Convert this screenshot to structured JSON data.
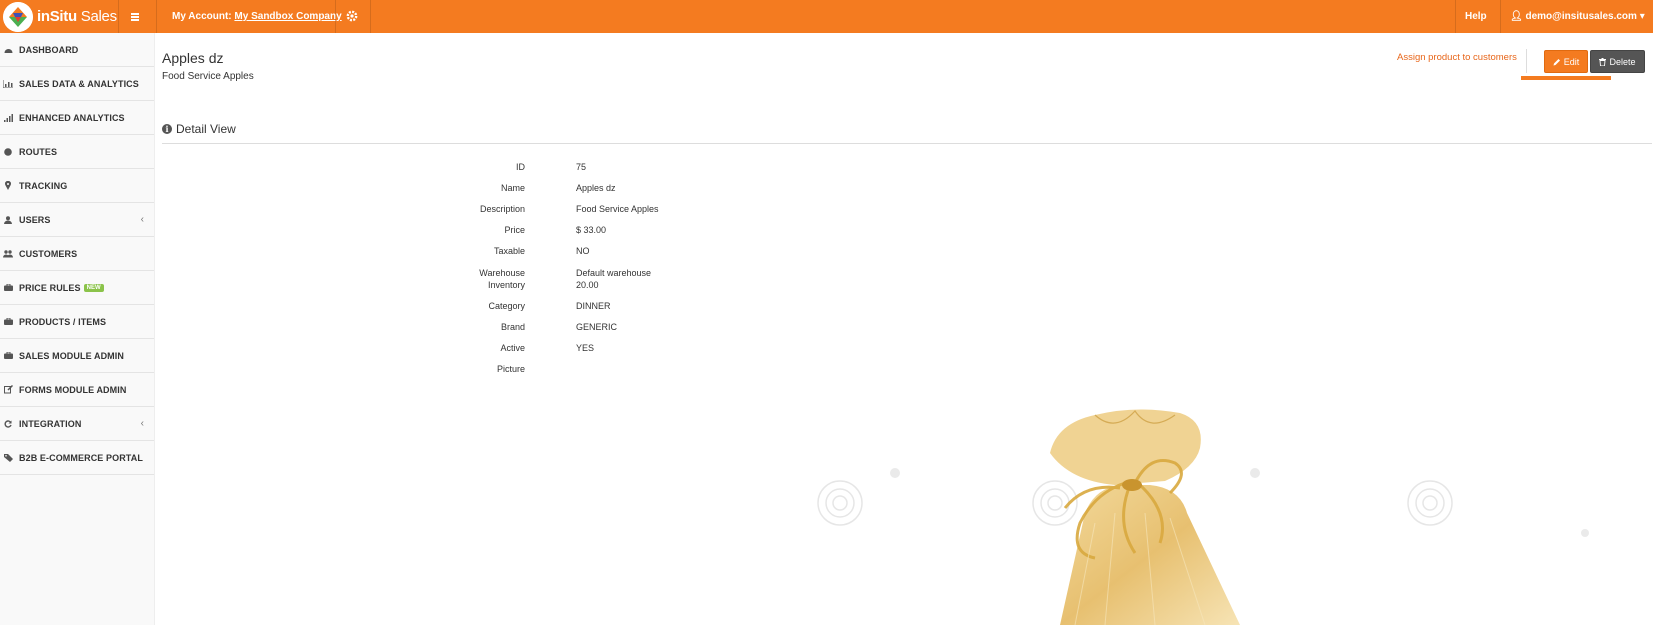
{
  "header": {
    "brand_bold": "inSitu",
    "brand_light": " Sales",
    "account_label": "My Account:",
    "account_name": "My Sandbox Company",
    "help": "Help",
    "user": "demo@insitusales.com"
  },
  "sidebar": {
    "items": [
      {
        "label": "DASHBOARD",
        "icon": "dashboard-icon"
      },
      {
        "label": "SALES DATA & ANALYTICS",
        "icon": "bar-chart-icon"
      },
      {
        "label": "ENHANCED ANALYTICS",
        "icon": "signal-icon"
      },
      {
        "label": "ROUTES",
        "icon": "globe-icon"
      },
      {
        "label": "TRACKING",
        "icon": "map-marker-icon"
      },
      {
        "label": "USERS",
        "icon": "user-icon"
      },
      {
        "label": "CUSTOMERS",
        "icon": "users-icon"
      },
      {
        "label": "PRICE RULES",
        "icon": "briefcase-icon",
        "badge": "NEW"
      },
      {
        "label": "PRODUCTS / ITEMS",
        "icon": "briefcase-icon"
      },
      {
        "label": "SALES MODULE ADMIN",
        "icon": "briefcase-icon"
      },
      {
        "label": "FORMS MODULE ADMIN",
        "icon": "edit-icon"
      },
      {
        "label": "INTEGRATION",
        "icon": "refresh-icon"
      },
      {
        "label": "B2B E-COMMERCE PORTAL",
        "icon": "tags-icon"
      }
    ]
  },
  "product": {
    "title": "Apples dz",
    "subtitle": "Food Service Apples",
    "assign_link": "Assign product to customers",
    "edit_label": "Edit",
    "delete_label": "Delete",
    "section_title": "Detail View"
  },
  "details": {
    "id_label": "ID",
    "id_value": "75",
    "name_label": "Name",
    "name_value": "Apples dz",
    "description_label": "Description",
    "description_value": "Food Service Apples",
    "price_label": "Price",
    "price_value": "$ 33.00",
    "taxable_label": "Taxable",
    "taxable_value": "NO",
    "warehouse_label_1": "Warehouse",
    "warehouse_label_2": "Inventory",
    "warehouse_value_1": "Default warehouse",
    "warehouse_value_2": "20.00",
    "category_label": "Category",
    "category_value": "DINNER",
    "brand_label": "Brand",
    "brand_value": "GENERIC",
    "active_label": "Active",
    "active_value": "YES",
    "picture_label": "Picture"
  },
  "colors": {
    "accent": "#f47b20",
    "dark_button": "#555555",
    "link": "#e8661a"
  }
}
